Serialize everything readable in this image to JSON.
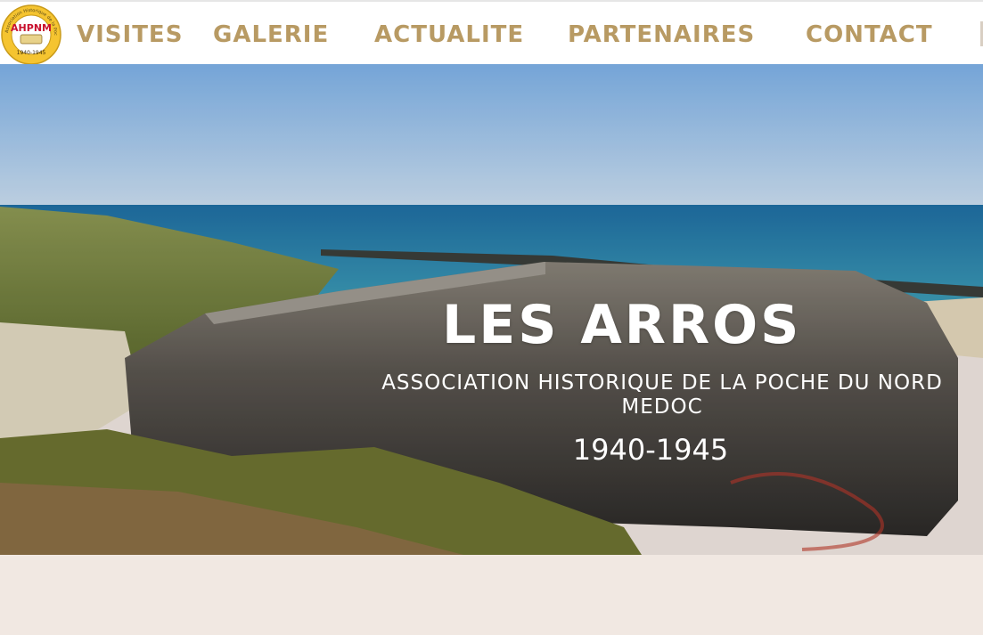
{
  "header": {
    "logo": {
      "text": "AHPNM",
      "ring_text": "Association Historique de la Poche du Nord Médoc",
      "years": "1940-1945",
      "accent": "#f5c430",
      "text_color": "#c8102e"
    },
    "nav": [
      "VISITES",
      "GALERIE",
      "ACTUALITE",
      "PARTENAIRES",
      "CONTACT"
    ],
    "nav_color": "#b89a63"
  },
  "hero": {
    "title": "LES ARROS",
    "subtitle": "ASSOCIATION HISTORIQUE DE LA POCHE DU NORD MEDOC",
    "years": "1940-1945"
  }
}
